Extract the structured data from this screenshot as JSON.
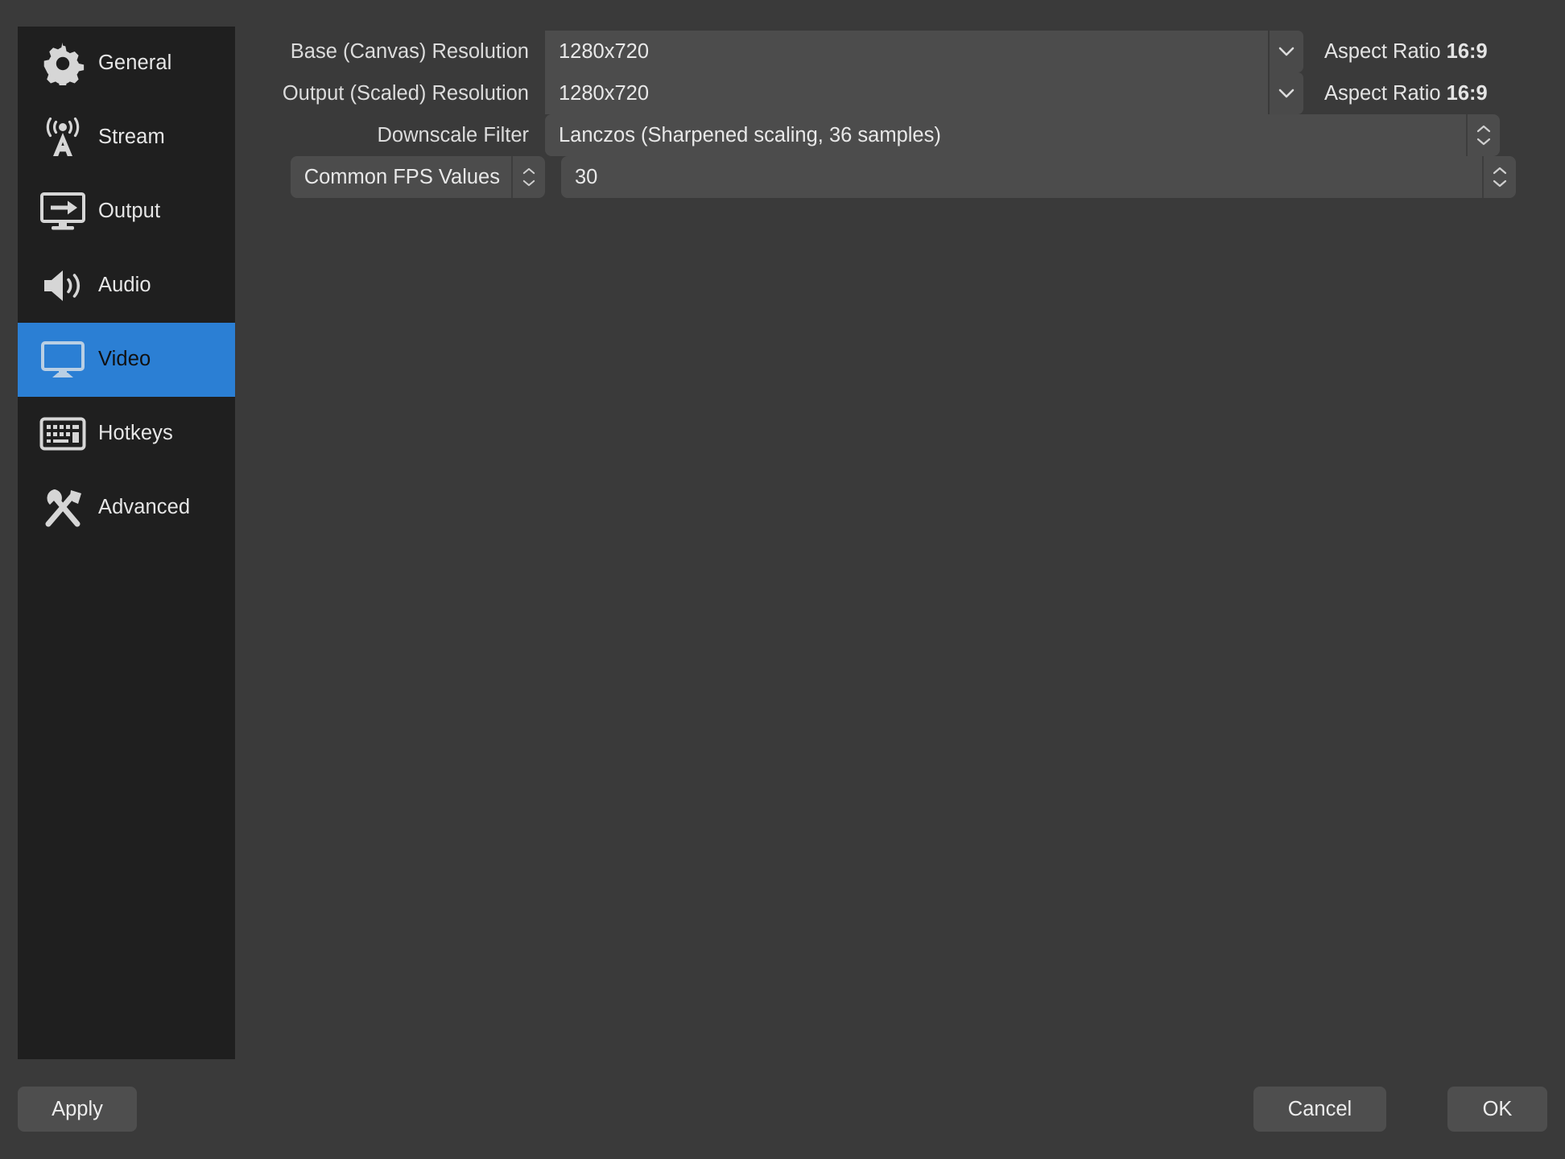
{
  "sidebar": {
    "items": [
      {
        "label": "General",
        "icon": "gear-icon",
        "selected": false
      },
      {
        "label": "Stream",
        "icon": "broadcast-icon",
        "selected": false
      },
      {
        "label": "Output",
        "icon": "monitor-arrow-icon",
        "selected": false
      },
      {
        "label": "Audio",
        "icon": "speaker-icon",
        "selected": false
      },
      {
        "label": "Video",
        "icon": "monitor-icon",
        "selected": true
      },
      {
        "label": "Hotkeys",
        "icon": "keyboard-icon",
        "selected": false
      },
      {
        "label": "Advanced",
        "icon": "wrench-screwdriver-icon",
        "selected": false
      }
    ]
  },
  "video_settings": {
    "base_resolution": {
      "label": "Base (Canvas) Resolution",
      "value": "1280x720",
      "aspect_label": "Aspect Ratio",
      "aspect_value": "16:9",
      "arrow_icon": "chevron-down-icon"
    },
    "output_resolution": {
      "label": "Output (Scaled) Resolution",
      "value": "1280x720",
      "aspect_label": "Aspect Ratio",
      "aspect_value": "16:9",
      "arrow_icon": "chevron-down-icon"
    },
    "downscale_filter": {
      "label": "Downscale Filter",
      "value": "Lanczos (Sharpened scaling, 36 samples)",
      "stepper_icon": "stepper-up-down-icon"
    },
    "fps": {
      "type_label": "Common FPS Values",
      "value": "30",
      "stepper_icon": "stepper-up-down-icon"
    }
  },
  "footer": {
    "apply_label": "Apply",
    "cancel_label": "Cancel",
    "ok_label": "OK"
  },
  "colors": {
    "window_bg": "#3a3a3a",
    "sidebar_bg": "#1f1f1f",
    "accent_blue": "#2b7fd4",
    "field_bg": "#4c4c4c",
    "text": "#e6e6e6"
  }
}
